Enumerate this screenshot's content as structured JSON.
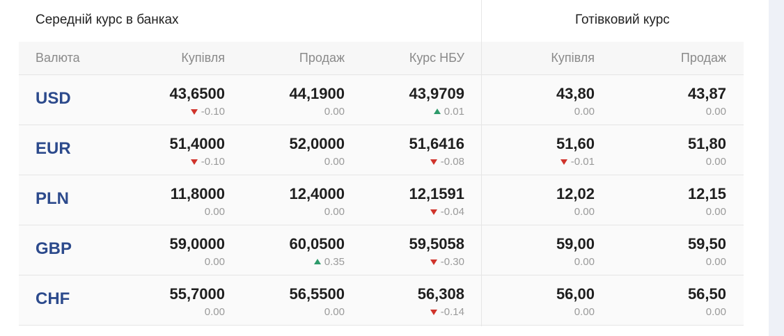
{
  "header": {
    "avg_title": "Середній курс в банках",
    "cash_title": "Готівковий курс"
  },
  "columns": {
    "currency": "Валюта",
    "buy": "Купівля",
    "sell": "Продаж",
    "nbu": "Курс НБУ",
    "cash_buy": "Купівля",
    "cash_sell": "Продаж"
  },
  "rows": [
    {
      "code": "USD",
      "buy": {
        "value": "43,6500",
        "change": "-0.10",
        "dir": "down"
      },
      "sell": {
        "value": "44,1900",
        "change": "0.00",
        "dir": "none"
      },
      "nbu": {
        "value": "43,9709",
        "change": "0.01",
        "dir": "up"
      },
      "cash_buy": {
        "value": "43,80",
        "change": "0.00",
        "dir": "none"
      },
      "cash_sell": {
        "value": "43,87",
        "change": "0.00",
        "dir": "none"
      }
    },
    {
      "code": "EUR",
      "buy": {
        "value": "51,4000",
        "change": "-0.10",
        "dir": "down"
      },
      "sell": {
        "value": "52,0000",
        "change": "0.00",
        "dir": "none"
      },
      "nbu": {
        "value": "51,6416",
        "change": "-0.08",
        "dir": "down"
      },
      "cash_buy": {
        "value": "51,60",
        "change": "-0.01",
        "dir": "down"
      },
      "cash_sell": {
        "value": "51,80",
        "change": "0.00",
        "dir": "none"
      }
    },
    {
      "code": "PLN",
      "buy": {
        "value": "11,8000",
        "change": "0.00",
        "dir": "none"
      },
      "sell": {
        "value": "12,4000",
        "change": "0.00",
        "dir": "none"
      },
      "nbu": {
        "value": "12,1591",
        "change": "-0.04",
        "dir": "down"
      },
      "cash_buy": {
        "value": "12,02",
        "change": "0.00",
        "dir": "none"
      },
      "cash_sell": {
        "value": "12,15",
        "change": "0.00",
        "dir": "none"
      }
    },
    {
      "code": "GBP",
      "buy": {
        "value": "59,0000",
        "change": "0.00",
        "dir": "none"
      },
      "sell": {
        "value": "60,0500",
        "change": "0.35",
        "dir": "up"
      },
      "nbu": {
        "value": "59,5058",
        "change": "-0.30",
        "dir": "down"
      },
      "cash_buy": {
        "value": "59,00",
        "change": "0.00",
        "dir": "none"
      },
      "cash_sell": {
        "value": "59,50",
        "change": "0.00",
        "dir": "none"
      }
    },
    {
      "code": "CHF",
      "buy": {
        "value": "55,7000",
        "change": "0.00",
        "dir": "none"
      },
      "sell": {
        "value": "56,5500",
        "change": "0.00",
        "dir": "none"
      },
      "nbu": {
        "value": "56,308",
        "change": "-0.14",
        "dir": "down"
      },
      "cash_buy": {
        "value": "56,00",
        "change": "0.00",
        "dir": "none"
      },
      "cash_sell": {
        "value": "56,50",
        "change": "0.00",
        "dir": "none"
      }
    }
  ],
  "colors": {
    "currency": "#2c4a8c",
    "down": "#d0342c",
    "up": "#2e9b6b"
  }
}
